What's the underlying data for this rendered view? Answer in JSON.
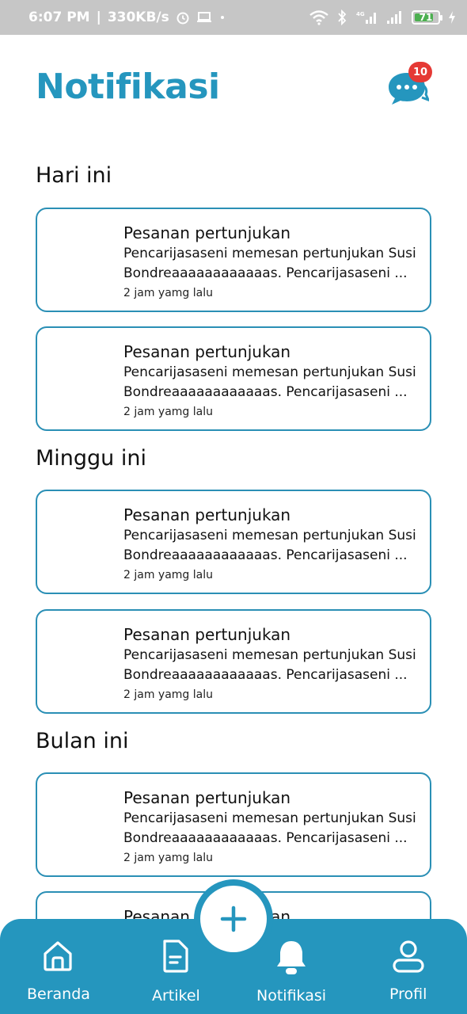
{
  "status_bar": {
    "time": "6:07 PM",
    "speed": "330KB/s",
    "battery": "71",
    "network": "4G"
  },
  "header": {
    "title": "Notifikasi",
    "chat_badge": "10"
  },
  "sections": [
    {
      "title": "Hari ini",
      "items": [
        {
          "title": "Pesanan pertunjukan",
          "body": "Pencarijasaseni memesan pertunjukan Susi Bondreaaaaaaaaaaaas. Pencarijasaseni ...",
          "time": "2 jam yamg lalu"
        },
        {
          "title": "Pesanan pertunjukan",
          "body": "Pencarijasaseni memesan pertunjukan Susi Bondreaaaaaaaaaaaas. Pencarijasaseni ...",
          "time": "2 jam yamg lalu"
        }
      ]
    },
    {
      "title": "Minggu ini",
      "items": [
        {
          "title": "Pesanan pertunjukan",
          "body": "Pencarijasaseni memesan pertunjukan Susi Bondreaaaaaaaaaaaas. Pencarijasaseni ...",
          "time": "2 jam yamg lalu"
        },
        {
          "title": "Pesanan pertunjukan",
          "body": "Pencarijasaseni memesan pertunjukan Susi Bondreaaaaaaaaaaaas. Pencarijasaseni ...",
          "time": "2 jam yamg lalu"
        }
      ]
    },
    {
      "title": "Bulan ini",
      "items": [
        {
          "title": "Pesanan pertunjukan",
          "body": "Pencarijasaseni memesan pertunjukan Susi Bondreaaaaaaaaaaaas. Pencarijasaseni ...",
          "time": "2 jam yamg lalu"
        },
        {
          "title": "Pesanan pertunjukan",
          "body": "",
          "time": ""
        }
      ]
    }
  ],
  "bottom_nav": {
    "items": [
      {
        "label": "Beranda",
        "icon": "home-icon"
      },
      {
        "label": "Artikel",
        "icon": "article-icon"
      },
      {
        "label": "Notifikasi",
        "icon": "bell-icon"
      },
      {
        "label": "Profil",
        "icon": "user-icon"
      }
    ],
    "fab_icon": "plus-icon"
  },
  "colors": {
    "primary": "#2596be",
    "badge": "#e53935",
    "card_border": "#2a8fb5"
  }
}
